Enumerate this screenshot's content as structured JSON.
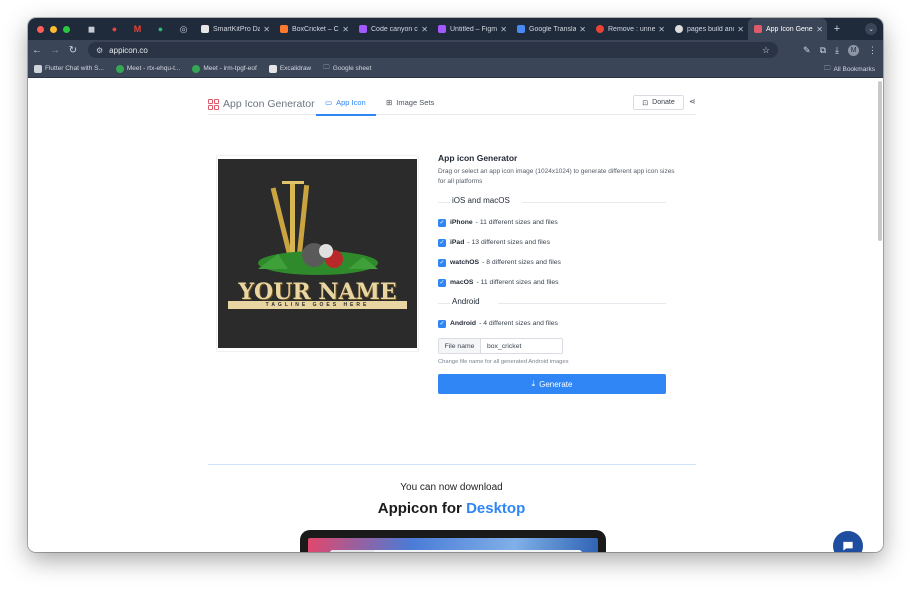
{
  "browser": {
    "pinned_tabs": [
      "●",
      "M",
      "●"
    ],
    "tabs": [
      {
        "title": "SmartKitPro Da",
        "color": "#e6e6e6"
      },
      {
        "title": "BoxCricket – Cr",
        "color": "#ff7a2f"
      },
      {
        "title": "Code canyon ca",
        "color": "#a259ff"
      },
      {
        "title": "Untitled – Figm",
        "color": "#a259ff"
      },
      {
        "title": "Google Transla",
        "color": "#4a8af4"
      },
      {
        "title": "Remove : unne",
        "color": "#ea4335"
      },
      {
        "title": "pages build and",
        "color": "#dddddd"
      },
      {
        "title": "App Icon Gene",
        "color": "#e05b6a",
        "active": true
      }
    ],
    "url": "appicon.co",
    "profile_initial": "M",
    "bookmarks": [
      "Flutter Chat with S...",
      "Meet - rtx-ehqu-t...",
      "Meet - irm-tpgf-eof",
      "Excalidraw",
      "Google sheet"
    ],
    "all_bookmarks": "All Bookmarks"
  },
  "header": {
    "logo_text": "App Icon Generator",
    "tab_app_icon": "App Icon",
    "tab_image_sets": "Image Sets",
    "donate": "Donate"
  },
  "preview": {
    "name_text": "YOUR NAME",
    "tagline_text": "TAGLINE GOES HERE"
  },
  "form": {
    "title": "App icon Generator",
    "description": "Drag or select an app icon image (1024x1024) to generate different app icon sizes for all platforms",
    "ios_section": "iOS and macOS",
    "options_ios": [
      {
        "name": "iPhone",
        "detail": "- 11 different sizes and files"
      },
      {
        "name": "iPad",
        "detail": "- 13 different sizes and files"
      },
      {
        "name": "watchOS",
        "detail": "- 8 different sizes and files"
      },
      {
        "name": "macOS",
        "detail": "- 11 different sizes and files"
      }
    ],
    "android_section": "Android",
    "option_android": {
      "name": "Android",
      "detail": "- 4 different sizes and files"
    },
    "file_name_label": "File name",
    "file_name_value": "box_cricket",
    "help_text": "Change file name for all generated Android images",
    "generate": "Generate"
  },
  "promo": {
    "subtitle": "You can now download",
    "title_prefix": "Appicon for",
    "title_accent": "Desktop"
  },
  "colors": {
    "accent": "#2f86f4",
    "tabstrip": "#1f2a3b",
    "toolbar": "#3a4558"
  }
}
